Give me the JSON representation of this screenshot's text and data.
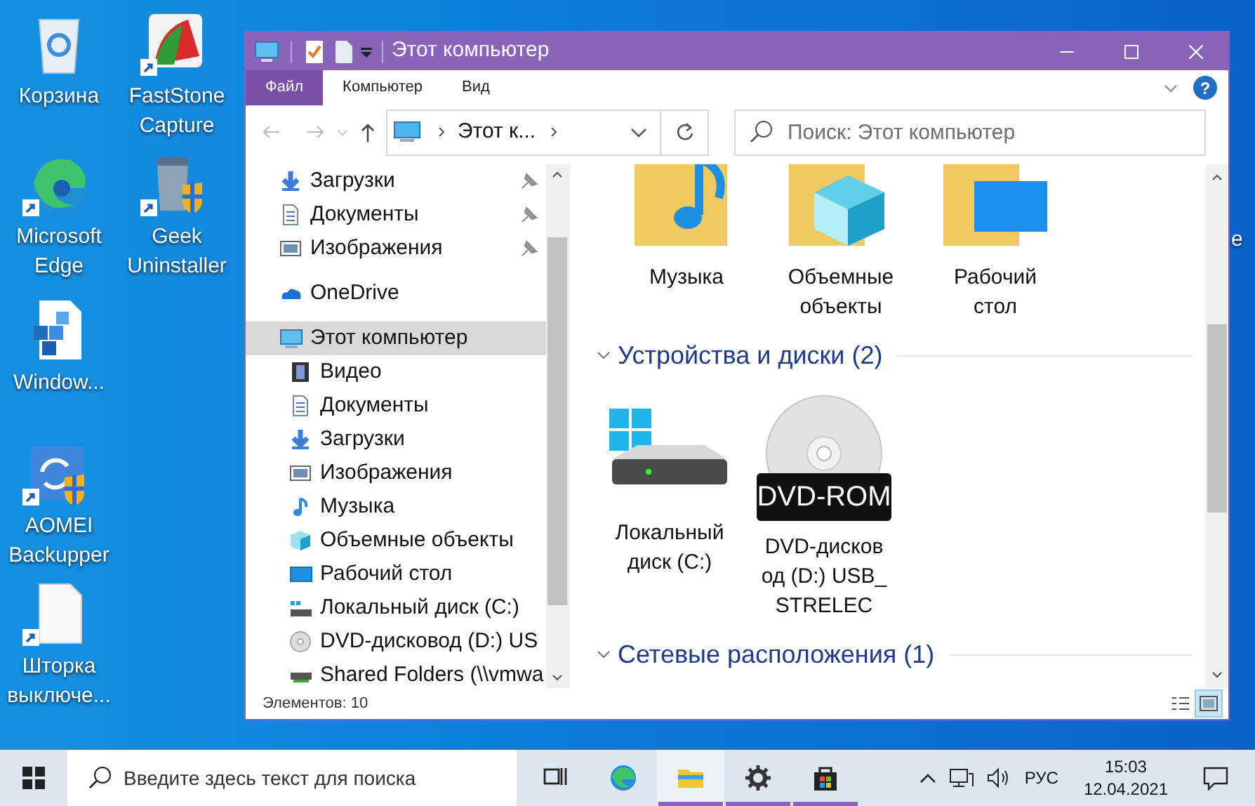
{
  "desktop_icons": [
    {
      "label": "Корзина",
      "shortcut": false
    },
    {
      "label": "FastStone Capture",
      "shortcut": true
    },
    {
      "label": "Microsoft Edge",
      "shortcut": true
    },
    {
      "label": "Geek Uninstaller",
      "shortcut": true
    },
    {
      "label": "Window...",
      "shortcut": false
    },
    {
      "label": "AOMEI Backupper",
      "shortcut": true
    },
    {
      "label": "Шторка выключе...",
      "shortcut": true
    }
  ],
  "desktop_partial_label": "e",
  "window": {
    "title": "Этот компьютер"
  },
  "ribbon_tabs": [
    {
      "label": "Файл",
      "selected": true
    },
    {
      "label": "Компьютер",
      "selected": false
    },
    {
      "label": "Вид",
      "selected": false
    }
  ],
  "help": "?",
  "address": {
    "path": "Этот к..."
  },
  "search": {
    "placeholder": "Поиск: Этот компьютер"
  },
  "navigation": [
    {
      "label": "Загрузки",
      "pinned": true,
      "selected": false
    },
    {
      "label": "Документы",
      "pinned": true,
      "selected": false
    },
    {
      "label": "Изображения",
      "pinned": true,
      "selected": false
    },
    {
      "label": "OneDrive",
      "pinned": false,
      "selected": false
    },
    {
      "label": "Этот компьютер",
      "pinned": false,
      "selected": true,
      "children": [
        {
          "label": "Видео",
          "pinned": false,
          "selected": false
        },
        {
          "label": "Документы",
          "pinned": false,
          "selected": false
        },
        {
          "label": "Загрузки",
          "pinned": false,
          "selected": false
        },
        {
          "label": "Изображения",
          "pinned": false,
          "selected": false
        },
        {
          "label": "Музыка",
          "pinned": false,
          "selected": false
        },
        {
          "label": "Объемные объекты",
          "pinned": false,
          "selected": false
        },
        {
          "label": "Рабочий стол",
          "pinned": false,
          "selected": false
        },
        {
          "label": "Локальный диск (C:)",
          "pinned": false,
          "selected": false
        },
        {
          "label": "DVD-дисковод (D:) US",
          "pinned": false,
          "selected": false
        },
        {
          "label": "Shared Folders (\\\\vmwa",
          "pinned": false,
          "selected": false
        }
      ]
    }
  ],
  "folders": [
    {
      "label": "Музыка"
    },
    {
      "label": "Объемные объекты"
    },
    {
      "label": "Рабочий стол"
    }
  ],
  "groups": [
    {
      "title": "Устройства и диски (2)",
      "expanded": true,
      "items": [
        {
          "kind": "drive",
          "label": "Локальный диск (C:)"
        },
        {
          "kind": "dvd",
          "label": "DVD-дисковод (D:) USB_STRELEC",
          "badge": "DVD-ROM"
        }
      ]
    },
    {
      "title": "Сетевые расположения (1)",
      "expanded": true
    }
  ],
  "status_bar": {
    "text": "Элементов: 10",
    "views": [
      {
        "selected": false
      },
      {
        "selected": true
      }
    ]
  },
  "taskbar": {
    "search_placeholder": "Введите здесь текст для поиска",
    "apps": [
      {
        "running": false,
        "active": false
      },
      {
        "running": false,
        "active": false
      },
      {
        "running": true,
        "active": true
      },
      {
        "running": true,
        "active": false
      },
      {
        "running": true,
        "active": false
      }
    ],
    "language": "РУС",
    "time": "15:03",
    "date": "12.04.2021"
  }
}
